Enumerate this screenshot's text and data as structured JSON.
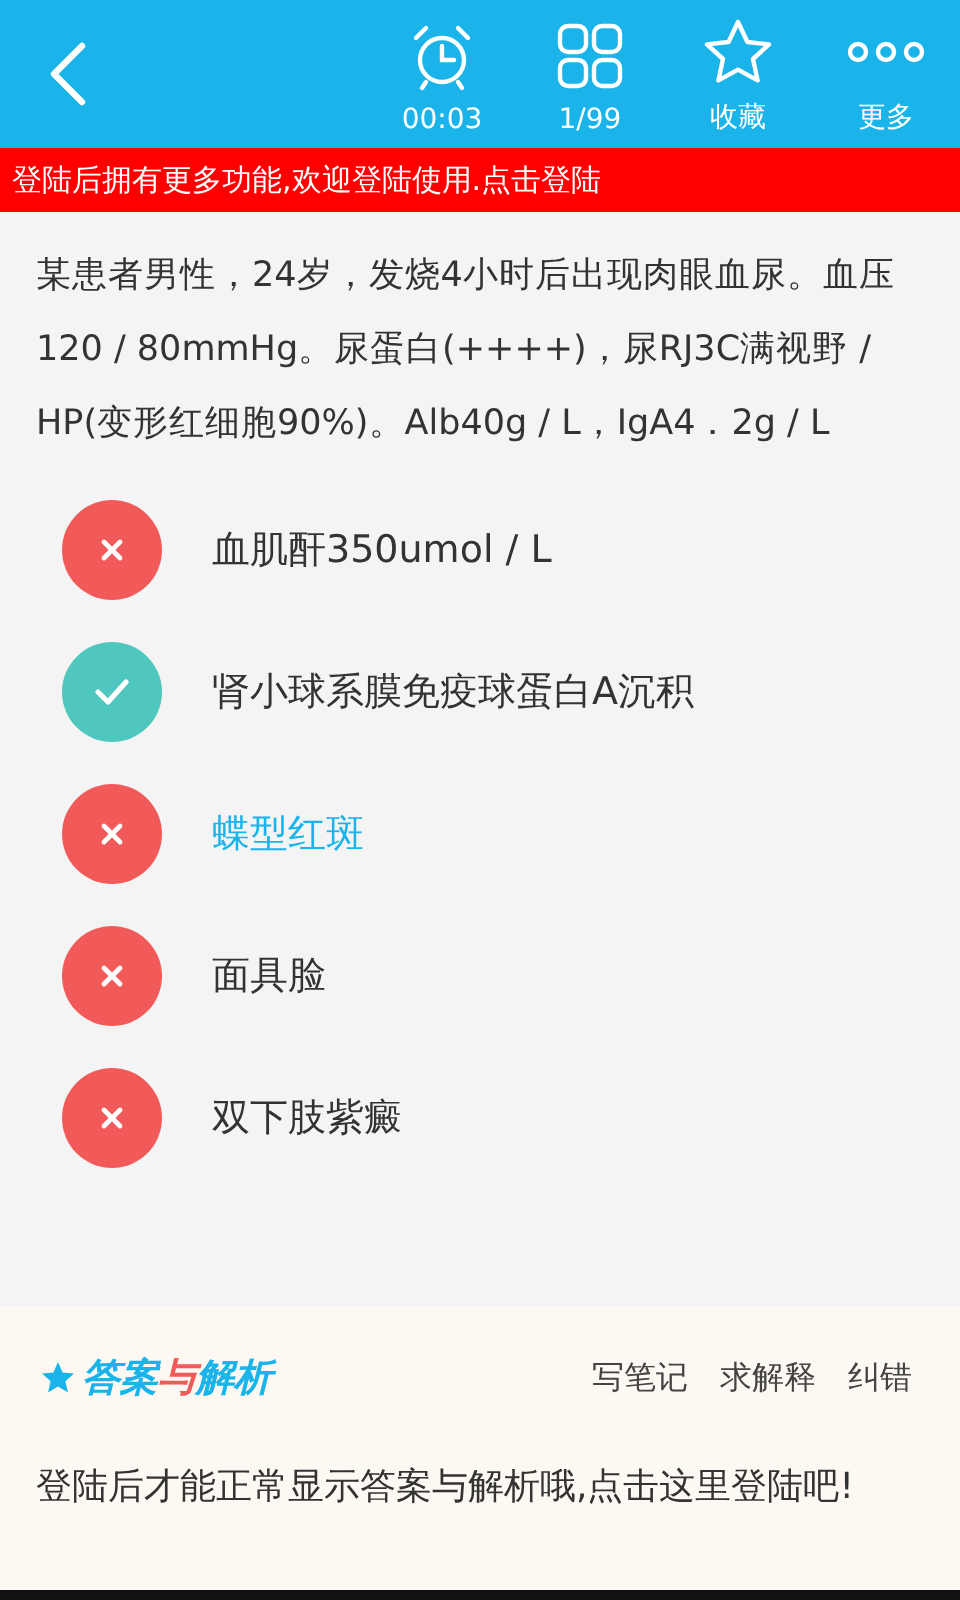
{
  "toolbar": {
    "items": [
      {
        "kind": "timer",
        "label": "00:03"
      },
      {
        "kind": "grid",
        "label": "1/99"
      },
      {
        "kind": "star",
        "label": "收藏"
      },
      {
        "kind": "more",
        "label": "更多"
      }
    ]
  },
  "login_banner": "登陆后拥有更多功能,欢迎登陆使用.点击登陆",
  "question": "某患者男性，24岁，发烧4小时后出现肉眼血尿。血压120 / 80mmHg。尿蛋白(++++)，尿RJ3C满视野 / HP(变形红细胞90%)。Alb40g / L，IgA4．2g / L",
  "options": [
    {
      "text": "血肌酐350umol / L",
      "correct": false,
      "selected": false
    },
    {
      "text": "肾小球系膜免疫球蛋白A沉积",
      "correct": true,
      "selected": false
    },
    {
      "text": "蝶型红斑",
      "correct": false,
      "selected": true
    },
    {
      "text": "面具脸",
      "correct": false,
      "selected": false
    },
    {
      "text": "双下肢紫癜",
      "correct": false,
      "selected": false
    }
  ],
  "answer_section": {
    "title_parts": [
      {
        "text": "答案",
        "color": "#1ab4ea"
      },
      {
        "text": "与",
        "color": "#f25a5a"
      },
      {
        "text": "解析",
        "color": "#1ab4ea"
      }
    ],
    "actions": [
      "写笔记",
      "求解释",
      "纠错"
    ],
    "message": "登陆后才能正常显示答案与解析哦,点击这里登陆吧!"
  }
}
